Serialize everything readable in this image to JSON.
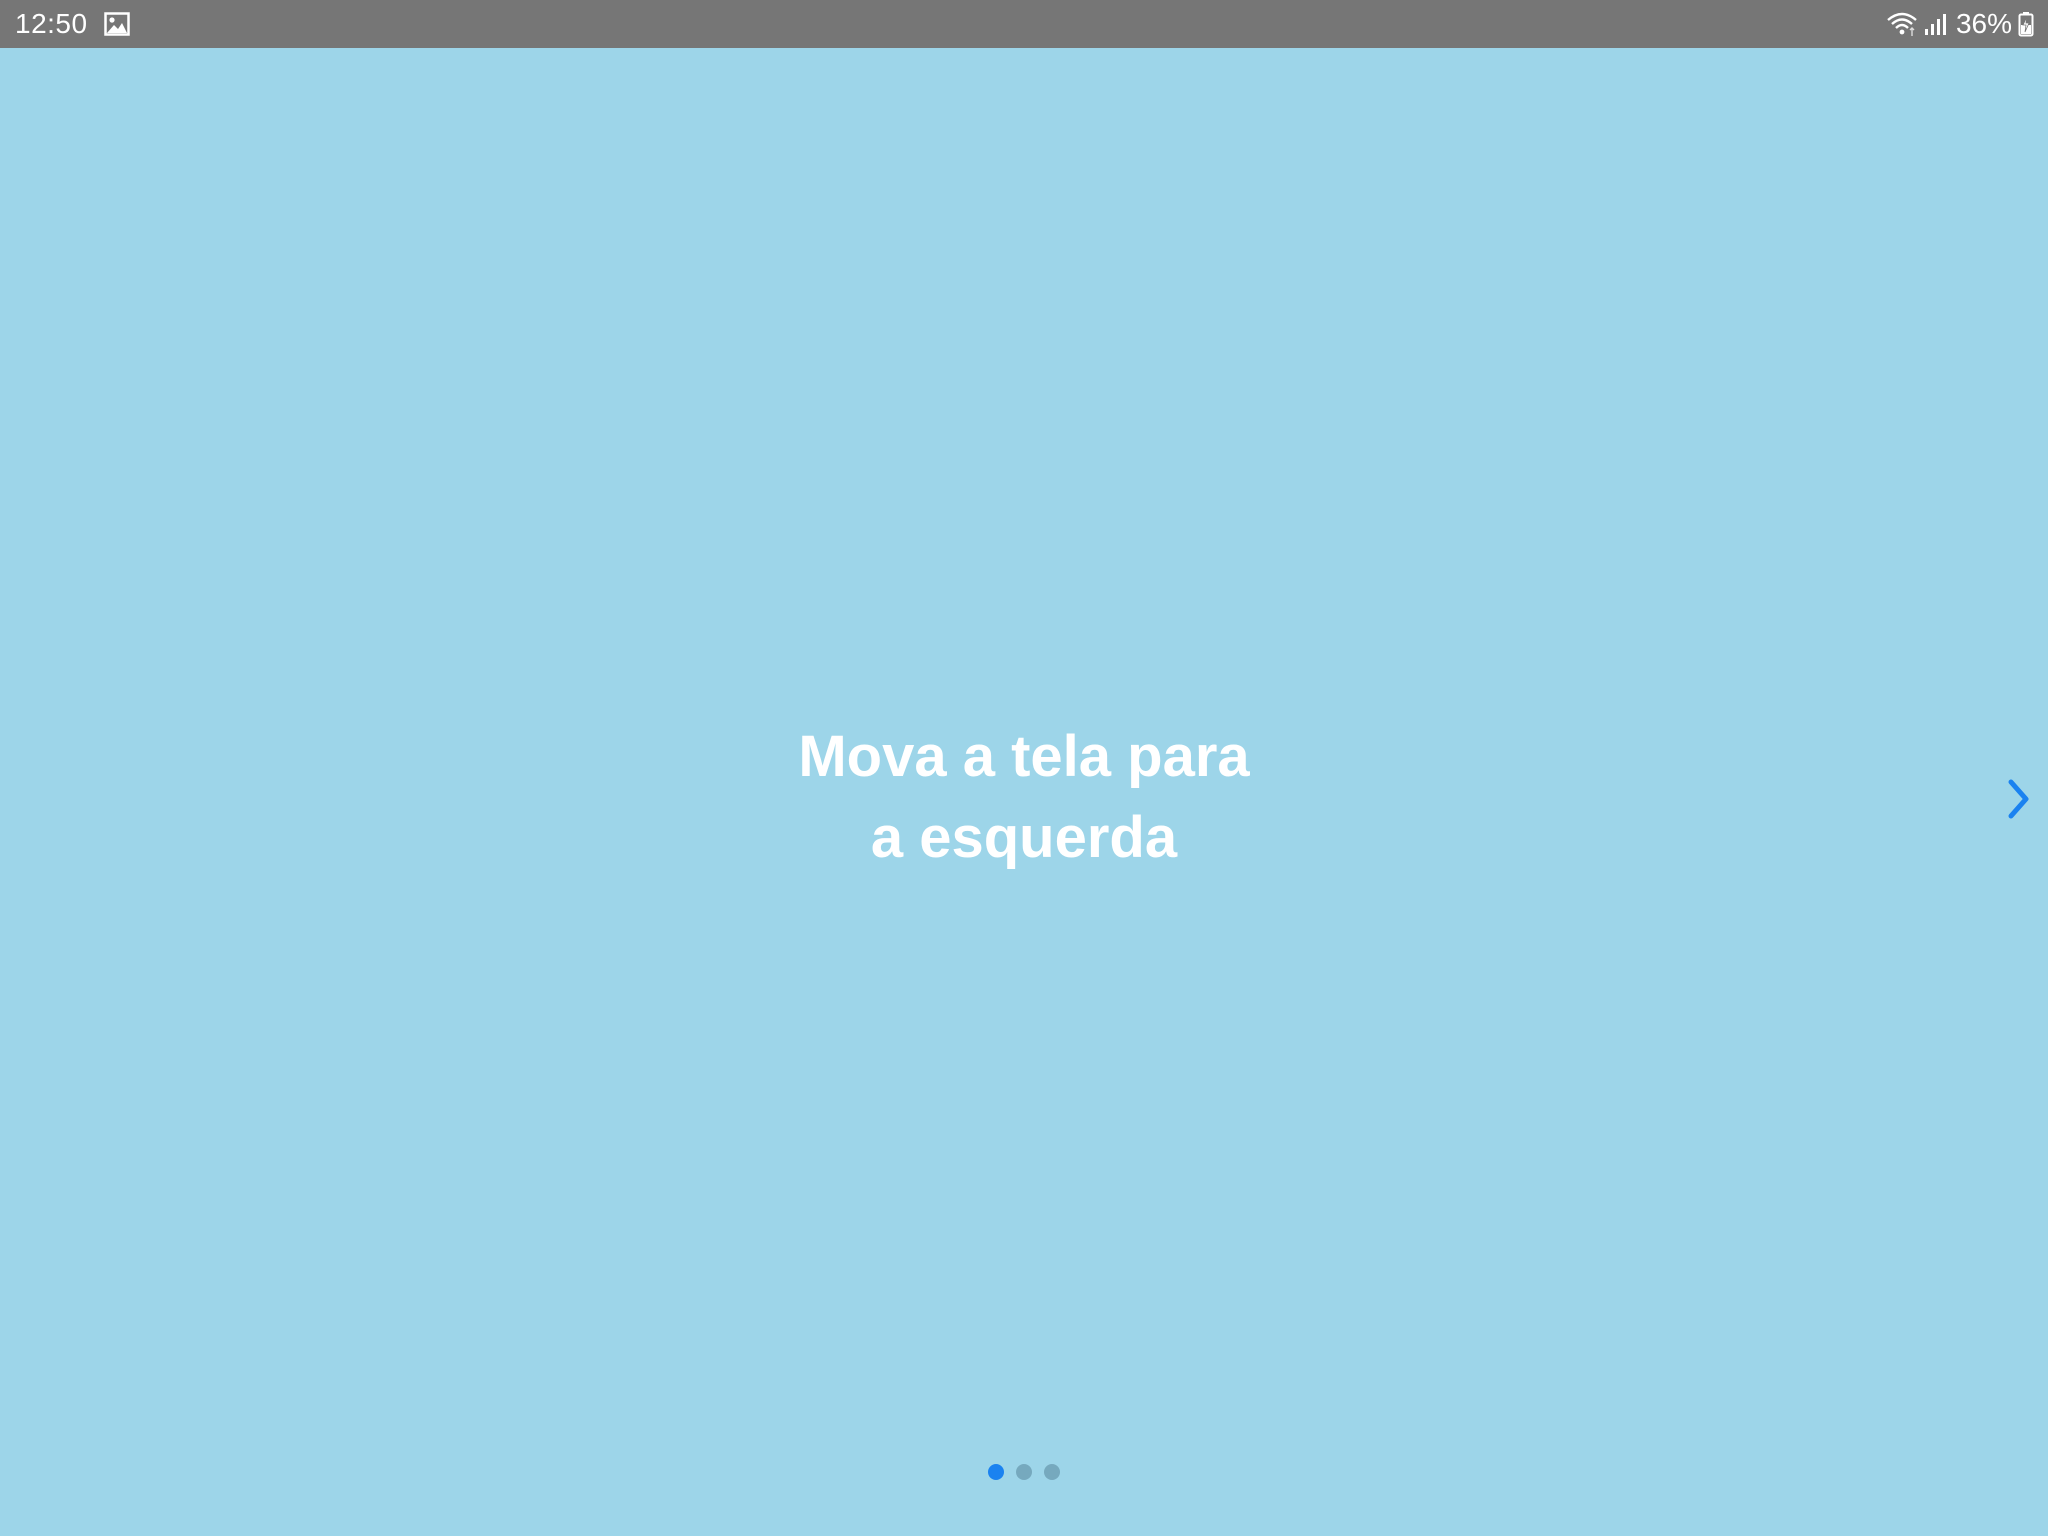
{
  "status_bar": {
    "time": "12:50",
    "battery_percent": "36%",
    "icons": [
      "gallery-icon",
      "wifi-icon",
      "signal-icon",
      "battery-charging-icon"
    ]
  },
  "onboarding": {
    "line1": "Mova a tela para",
    "line2": "a esquerda"
  },
  "navigation": {
    "next_icon": "chevron-right-icon"
  },
  "page_indicator": {
    "total_pages": 3,
    "active_page": 1
  },
  "colors": {
    "background": "#9dd5e9",
    "status_bar": "#767676",
    "accent": "#1a82f0",
    "inactive_dot": "#76a9be",
    "text": "#ffffff"
  }
}
